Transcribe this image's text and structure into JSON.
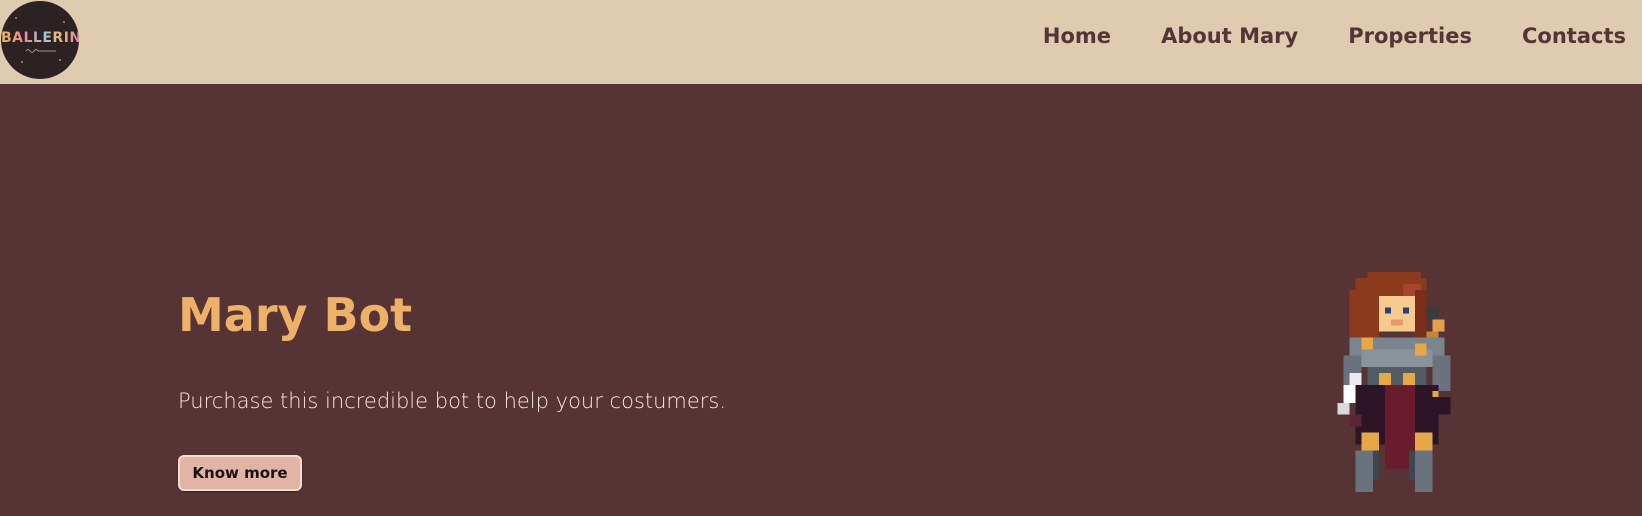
{
  "brand": {
    "logo_text": "BALLERINI"
  },
  "nav": {
    "items": [
      {
        "label": "Home"
      },
      {
        "label": "About Mary"
      },
      {
        "label": "Properties"
      },
      {
        "label": "Contacts"
      }
    ]
  },
  "hero": {
    "title": "Mary Bot",
    "subtitle": "Purchase this incredible bot to help your costumers.",
    "button_label": "Know more"
  },
  "colors": {
    "navbar_bg": "#dfcbb0",
    "page_bg": "#563436",
    "accent_title": "#eeb168",
    "button_bg": "#e2b4a6"
  }
}
